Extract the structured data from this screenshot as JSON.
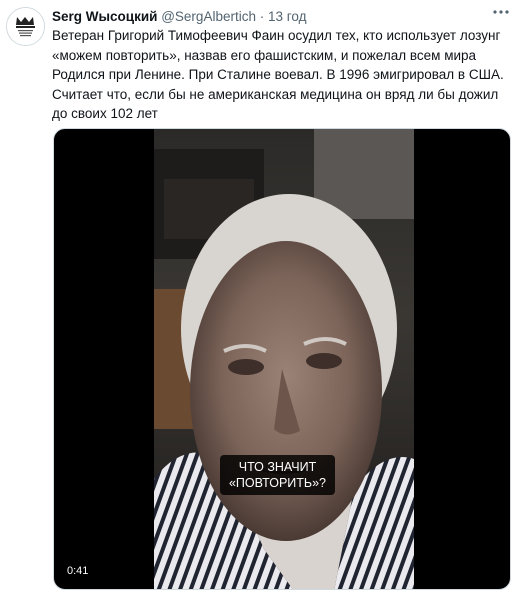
{
  "author": {
    "display_name": "Serg Wысоцкий",
    "handle": "@SergAlbertich",
    "separator": "·",
    "time": "13 год"
  },
  "more_icon": "more-dots-icon",
  "tweet": {
    "lines": [
      "Ветеран Григорий Тимофеевич Фаин осудил тех, кто использует лозунг «можем повторить», назвав его фашистским, и пожелал всем мира",
      "Родился при Ленине. При Сталине воевал. В 1996 эмигрировал в США.",
      "Считает что, если бы не американская медицина он вряд ли бы дожил до своих 102 лет"
    ]
  },
  "video": {
    "caption_line1": "ЧТО ЗНАЧИТ",
    "caption_line2": "«ПОВТОРИТЬ»?",
    "duration": "0:41"
  }
}
